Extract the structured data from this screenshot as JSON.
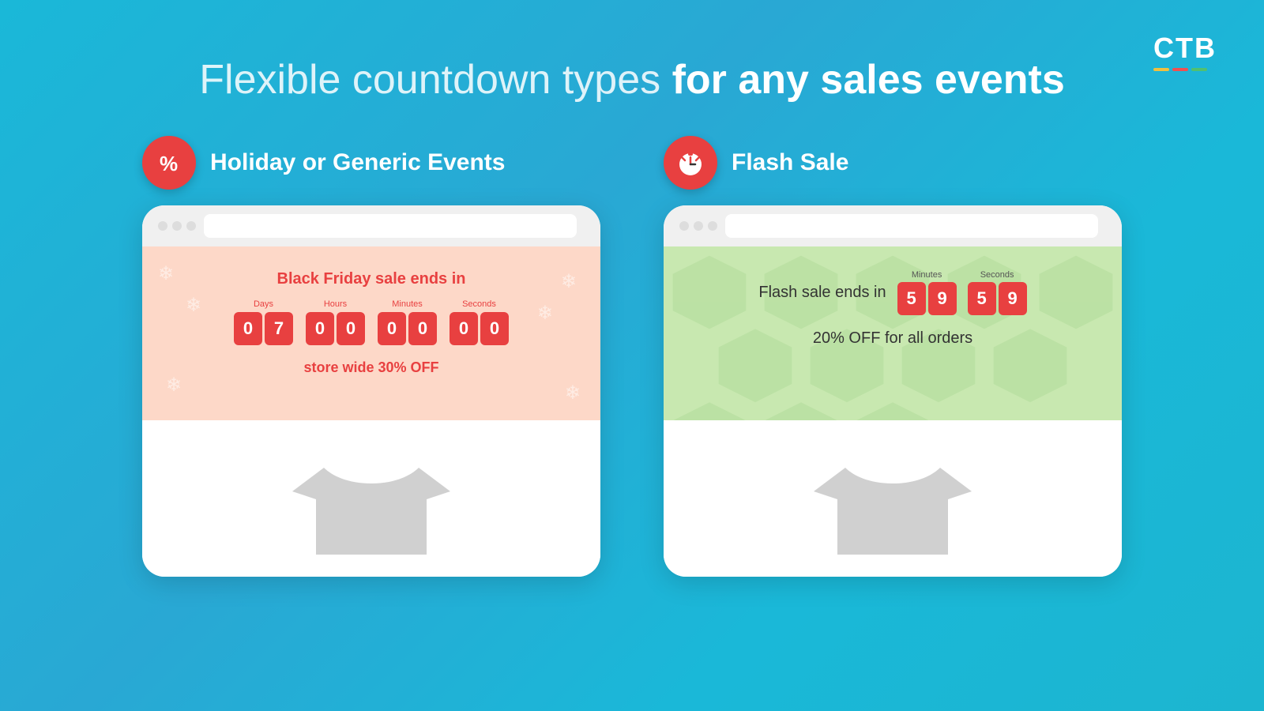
{
  "logo": {
    "text": "CTB",
    "underline_colors": [
      "#f0c040",
      "#f05050",
      "#50c070"
    ]
  },
  "heading": {
    "part1": "Flexible countdown types ",
    "part2": "for any sales events"
  },
  "left_column": {
    "category": "Holiday or Generic Events",
    "banner_title": "Black Friday sale ends in",
    "timer": {
      "days_label": "Days",
      "hours_label": "Hours",
      "minutes_label": "Minutes",
      "seconds_label": "Seconds",
      "days": [
        "0",
        "7"
      ],
      "hours": [
        "0",
        "0"
      ],
      "minutes": [
        "0",
        "0"
      ],
      "seconds": [
        "0",
        "0"
      ]
    },
    "subtext": "store wide 30% OFF"
  },
  "right_column": {
    "category": "Flash Sale",
    "banner_prefix": "Flash sale ends in",
    "minutes_label": "Minutes",
    "seconds_label": "Seconds",
    "minutes": [
      "5",
      "9"
    ],
    "seconds": [
      "5",
      "9"
    ],
    "subtext": "20% OFF for all orders"
  }
}
